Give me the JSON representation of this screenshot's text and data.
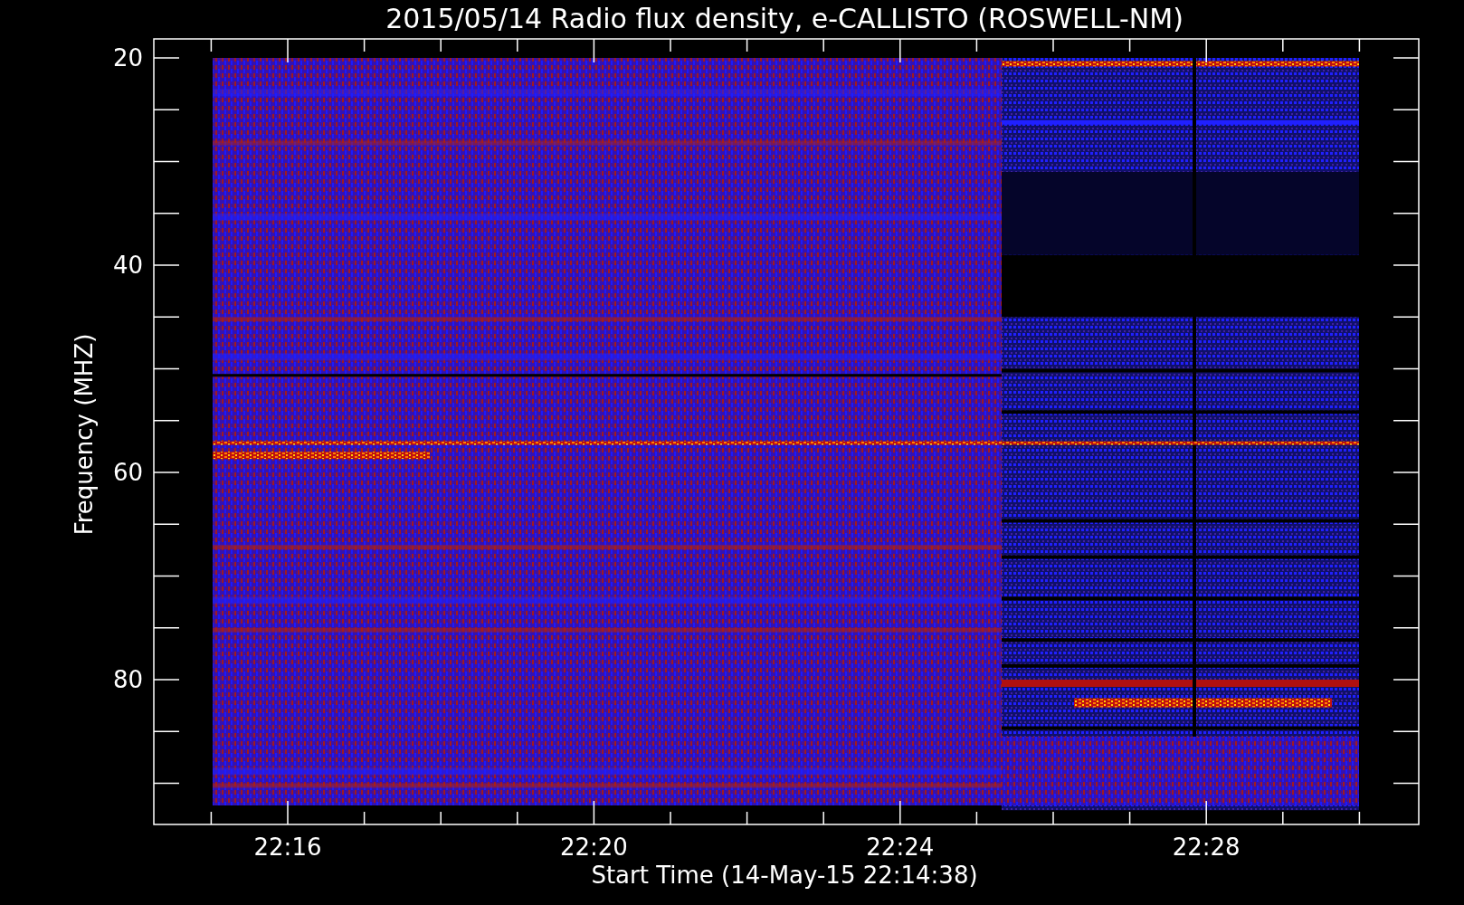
{
  "title": "2015/05/14  Radio flux density, e-CALLISTO (ROSWELL-NM)",
  "y_axis": {
    "label": "Frequency (MHZ)",
    "ticks": [
      "20",
      "40",
      "60",
      "80"
    ]
  },
  "x_axis": {
    "label": "Start Time (14-May-15 22:14:38)",
    "ticks": [
      "22:16",
      "22:20",
      "22:24",
      "22:28"
    ]
  }
}
